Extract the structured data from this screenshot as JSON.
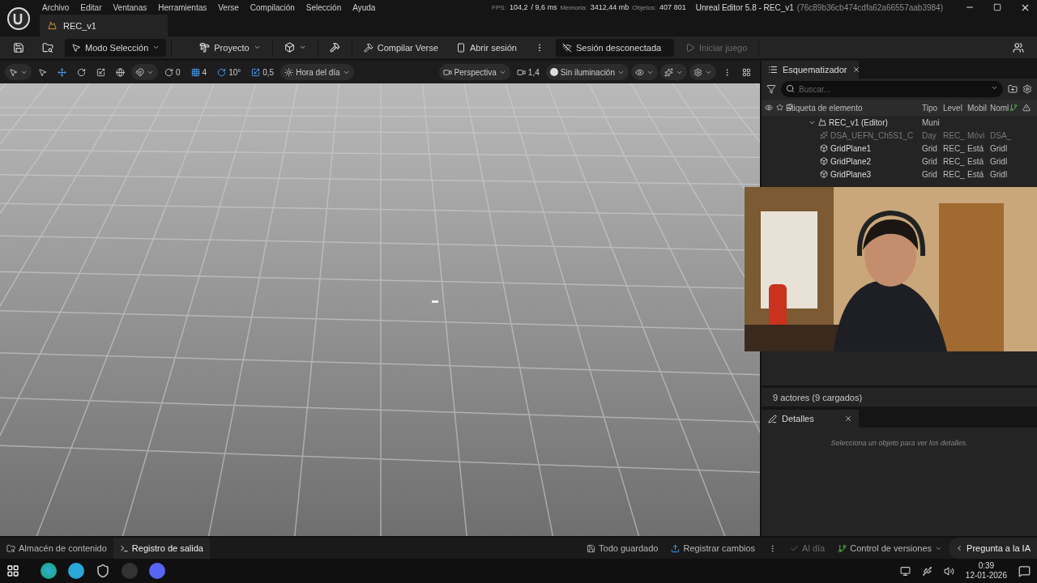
{
  "menu": [
    "Archivo",
    "Editar",
    "Ventanas",
    "Herramientas",
    "Verse",
    "Compilación",
    "Selección",
    "Ayuda"
  ],
  "perf": {
    "fps_label": "FPS:",
    "fps": "104,2",
    "ms": "/ 9,6 ms",
    "mem_label": "Memoria:",
    "mem": "3412,44 mb",
    "obj_label": "Objetos:",
    "obj": "407 801"
  },
  "window": {
    "title": "Unreal Editor 5.8 - REC_v1",
    "id": "(76c89b36cb474cdfa62a66557aab3984)"
  },
  "doc_tab": "REC_v1",
  "toolbar": {
    "mode": "Modo Selección",
    "project": "Proyecto",
    "compile": "Compilar Verse",
    "login": "Abrir sesión",
    "session": "Sesión desconectada",
    "play": {
      "label": "Iniciar juego",
      "disabled": true
    }
  },
  "viewport_toolbar": {
    "rotate_snap": "0",
    "grid": "4",
    "angle": "10°",
    "scale": "0,5",
    "time": "Hora del día",
    "view": "Perspectiva",
    "cam_speed": "1,4",
    "lighting": "Sin iluminación"
  },
  "outliner": {
    "title": "Esquematizador",
    "search": {
      "placeholder": "Buscar..."
    },
    "columns": [
      "Etiqueta de elemento",
      "Tipo",
      "Level",
      "Mobil",
      "Noml"
    ],
    "rows": [
      {
        "label": "REC_v1 (Editor)",
        "type": "Muni",
        "expanded": true,
        "dimmed": false,
        "children": [
          {
            "label": "DSA_UEFN_Ch5S1_C",
            "type": "Day",
            "level": "REC_",
            "mobility": "Móvi",
            "name": "DSA_",
            "dimmed": true
          },
          {
            "label": "GridPlane1",
            "type": "Grid",
            "level": "REC_",
            "mobility": "Está",
            "name": "Gridl",
            "dimmed": false
          },
          {
            "label": "GridPlane2",
            "type": "Grid",
            "level": "REC_",
            "mobility": "Está",
            "name": "Gridl",
            "dimmed": false
          },
          {
            "label": "GridPlane3",
            "type": "Grid",
            "level": "REC_",
            "mobility": "Está",
            "name": "Gridl",
            "dimmed": false
          }
        ]
      }
    ],
    "count": "9 actores (9 cargados)"
  },
  "details": {
    "title": "Detalles",
    "empty": "Selecciona un objeto para ver los detalles."
  },
  "status_bar": {
    "tabs": [
      {
        "label": "Almacén de contenido",
        "selected": false
      },
      {
        "label": "Registro de salida",
        "selected": true
      }
    ],
    "saved": "Todo guardado",
    "register": "Registrar cambios",
    "up_to_date": {
      "label": "Al día",
      "disabled": true
    },
    "version": "Control de versiones",
    "ai": "Pregunta a la IA"
  },
  "taskbar": {
    "time": "0:39",
    "date": "12-01-2026"
  }
}
